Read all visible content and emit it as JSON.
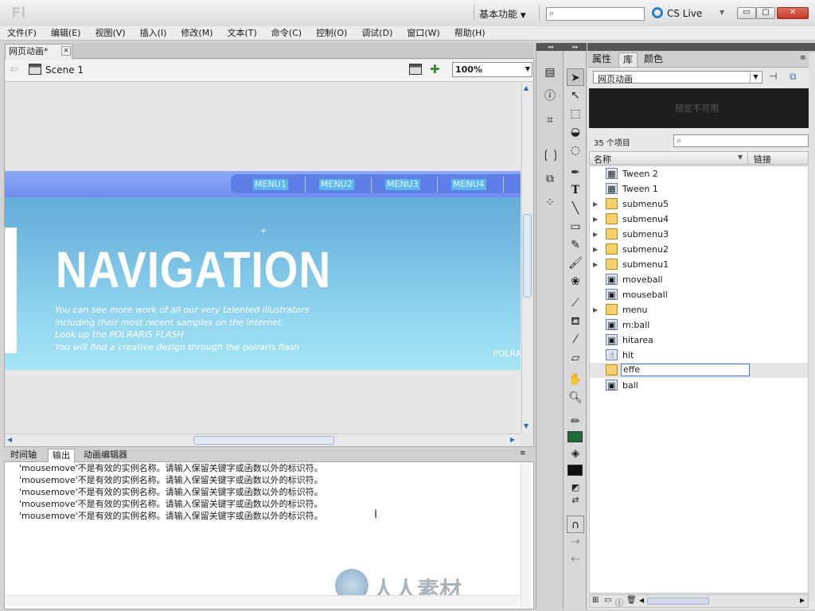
{
  "titlebar": {
    "app_logo": "Fl",
    "workspace": "基本功能",
    "workspace_arrow": "▼",
    "search_placeholder": "",
    "cs_live": "CS Live",
    "cs_live_arrow": "▼",
    "minimize": "▭",
    "maximize": "▢",
    "close": "✕"
  },
  "menubar": [
    "文件(F)",
    "编辑(E)",
    "视图(V)",
    "插入(I)",
    "修改(M)",
    "文本(T)",
    "命令(C)",
    "控制(O)",
    "调试(D)",
    "窗口(W)",
    "帮助(H)"
  ],
  "document": {
    "tab_label": "网页动画*",
    "tab_close": "✕",
    "scene_label": "Scene 1",
    "zoom": "100%"
  },
  "stage": {
    "menu_items": [
      "MENU1",
      "MENU2",
      "MENU3",
      "MENU4"
    ],
    "title": "NAVIGATION",
    "lines": [
      "You can see more work of all our very talented illustrators",
      "including their most recent samples on the internet.",
      "Look up the POLRARIS FLASH",
      "You will find a creative design through the polraris flash"
    ],
    "edge_text": "POLRA"
  },
  "bottom_panel": {
    "tabs": [
      "时间轴",
      "输出",
      "动画编辑器"
    ],
    "active_tab": 1,
    "output_lines": [
      "'mousemove'不是有效的实例名称。请输入保留关键字或函数以外的标识符。",
      "'mousemove'不是有效的实例名称。请输入保留关键字或函数以外的标识符。",
      "'mousemove'不是有效的实例名称。请输入保留关键字或函数以外的标识符。",
      "'mousemove'不是有效的实例名称。请输入保留关键字或函数以外的标识符。",
      "'mousemove'不是有效的实例名称。请输入保留关键字或函数以外的标识符。"
    ],
    "watermark": "人人素材"
  },
  "library": {
    "tabs": [
      "属性",
      "库",
      "颜色"
    ],
    "active_tab": 1,
    "document_select": "网页动画",
    "preview_text": "预览不可用",
    "item_count": "35 个项目",
    "search_placeholder": "",
    "col_name": "名称",
    "col_link": "链接",
    "items": [
      {
        "label": "Tween 2",
        "kind": "graphic",
        "expandable": false
      },
      {
        "label": "Tween 1",
        "kind": "graphic",
        "expandable": false
      },
      {
        "label": "submenu5",
        "kind": "folder",
        "expandable": true
      },
      {
        "label": "submenu4",
        "kind": "folder",
        "expandable": true
      },
      {
        "label": "submenu3",
        "kind": "folder",
        "expandable": true
      },
      {
        "label": "submenu2",
        "kind": "folder",
        "expandable": true
      },
      {
        "label": "submenu1",
        "kind": "folder",
        "expandable": true
      },
      {
        "label": "moveball",
        "kind": "movieclip",
        "expandable": false
      },
      {
        "label": "mouseball",
        "kind": "movieclip",
        "expandable": false
      },
      {
        "label": "menu",
        "kind": "folder",
        "expandable": true
      },
      {
        "label": "m:ball",
        "kind": "movieclip",
        "expandable": false
      },
      {
        "label": "hitarea",
        "kind": "movieclip",
        "expandable": false
      },
      {
        "label": "hit",
        "kind": "button",
        "expandable": false
      },
      {
        "label": "effe",
        "kind": "folder",
        "expandable": false,
        "editing": true
      },
      {
        "label": "ball",
        "kind": "movieclip",
        "expandable": false
      }
    ]
  },
  "colors": {
    "stroke": "#1e6b3a",
    "fill": "#111111"
  }
}
